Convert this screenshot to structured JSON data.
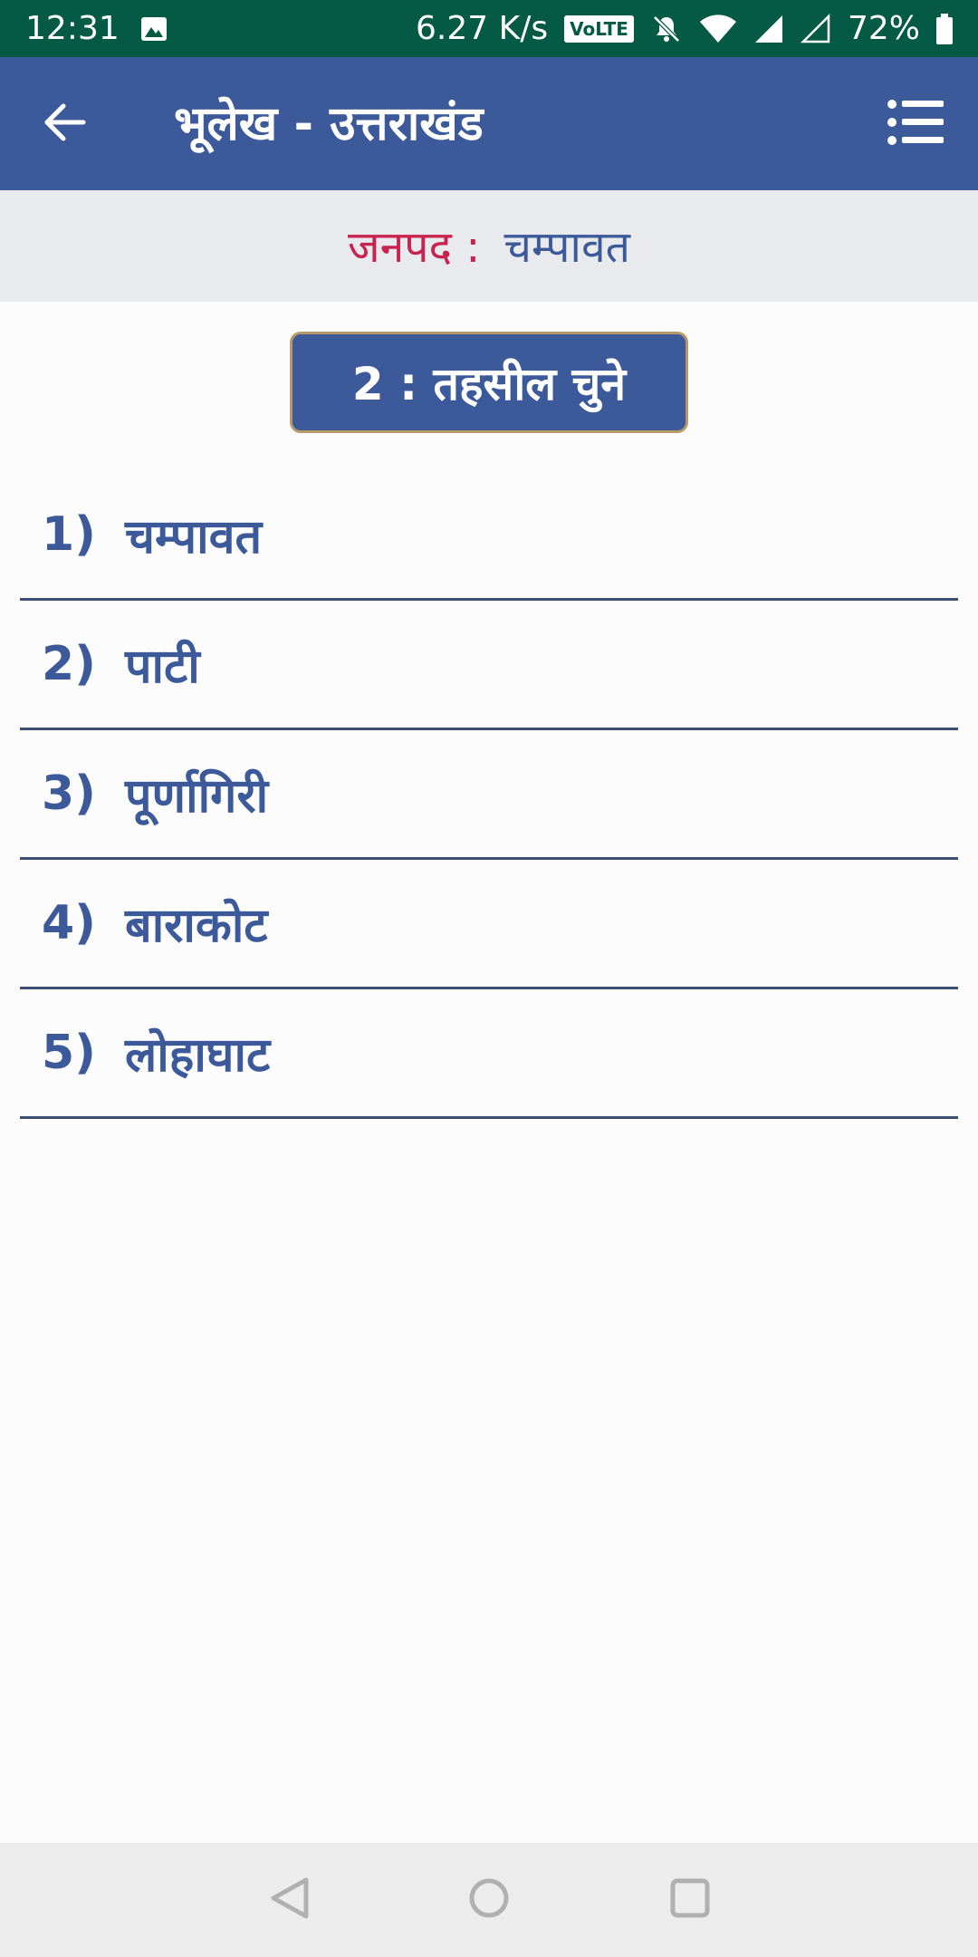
{
  "status_bar": {
    "time": "12:31",
    "network_speed": "6.27 K/s",
    "volte": "VoLTE",
    "battery": "72%",
    "icons": [
      "image-icon",
      "volte-icon",
      "mute-icon",
      "wifi-icon",
      "signal-icon",
      "signal-empty-icon",
      "battery-icon"
    ]
  },
  "app_bar": {
    "title": "भूलेख - उत्तराखंड",
    "back_icon": "arrow-left-icon",
    "menu_icon": "list-menu-icon"
  },
  "district": {
    "label": "जनपद :",
    "value": "चम्पावत"
  },
  "section": {
    "header": "2 : तहसील चुने"
  },
  "tehsils": [
    {
      "num": "1)",
      "name": "चम्पावत"
    },
    {
      "num": "2)",
      "name": "पाटी"
    },
    {
      "num": "3)",
      "name": "पूर्णागिरी"
    },
    {
      "num": "4)",
      "name": "बाराकोट"
    },
    {
      "num": "5)",
      "name": "लोहाघाट"
    }
  ],
  "nav_bar": {
    "icons": [
      "back-triangle-icon",
      "home-circle-icon",
      "recents-square-icon"
    ]
  },
  "colors": {
    "status_bar": "#045a44",
    "app_bar": "#3c5a9a",
    "accent_label": "#c8224f",
    "text_primary": "#3c5a9a"
  }
}
